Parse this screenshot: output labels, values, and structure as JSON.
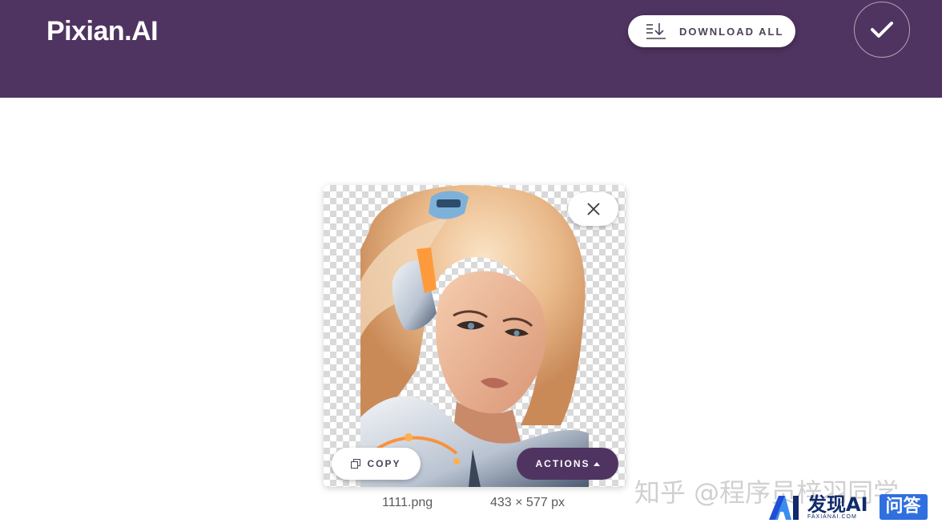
{
  "header": {
    "logo_text": "Pixian.AI",
    "download_all_label": "DOWNLOAD ALL",
    "done_icon": "checkmark-icon"
  },
  "result_card": {
    "image_description_icon": "cutout-image",
    "close_icon": "close-icon",
    "copy_label": "COPY",
    "copy_icon": "copy-icon",
    "actions_label": "ACTIONS",
    "actions_icon": "caret-up-icon",
    "filename": "1111.png",
    "dimensions": "433 × 577 px"
  },
  "watermark": {
    "text": "知乎 @程序员梓羽同学",
    "brand_main": "发现AI",
    "brand_sub": "FAXIANAI.COM",
    "qa_label": "问答"
  },
  "colors": {
    "brand_purple": "#4f3461",
    "button_text": "#4b4357"
  }
}
